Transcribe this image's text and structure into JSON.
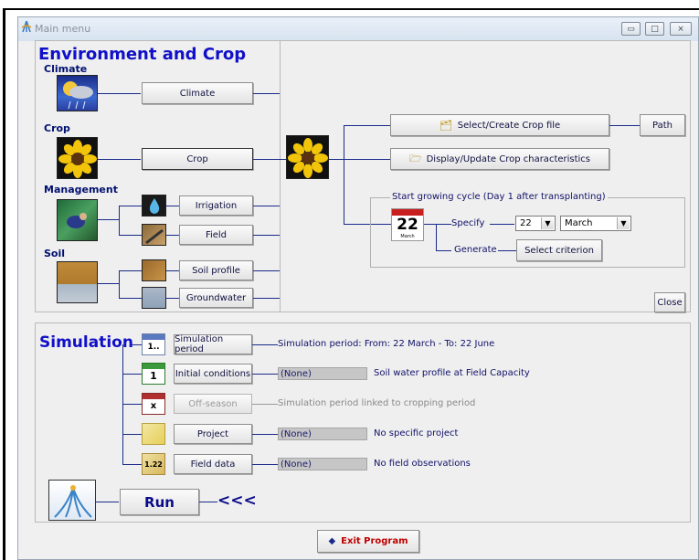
{
  "window": {
    "title": "Main menu",
    "controls": {
      "minimize": "▭",
      "maximize": "□",
      "close": "⨯"
    }
  },
  "environment": {
    "heading": "Environment and Crop",
    "climate": {
      "label": "Climate",
      "button": "Climate"
    },
    "crop": {
      "label": "Crop",
      "button": "Crop"
    },
    "management": {
      "label": "Management",
      "irrigation": "Irrigation",
      "field": "Field"
    },
    "soil": {
      "label": "Soil",
      "profile": "Soil profile",
      "groundwater": "Groundwater"
    }
  },
  "crop_panel": {
    "select_create": "Select/Create Crop file",
    "path": "Path",
    "display_update": "Display/Update Crop characteristics",
    "group_title": "Start growing cycle (Day 1 after transplanting)",
    "calendar_day": "22",
    "calendar_month": "March",
    "specify": "Specify",
    "day_value": "22",
    "month_value": "March",
    "generate": "Generate",
    "select_criterion": "Select criterion",
    "close": "Close"
  },
  "simulation": {
    "heading": "Simulation",
    "period_button": "Simulation period",
    "period_text": "Simulation period: From: 22 March - To: 22 June",
    "period_icon": "1..",
    "initial_button": "Initial conditions",
    "initial_value": "(None)",
    "initial_text": "Soil water profile at Field Capacity",
    "initial_icon": "1",
    "offseason_button": "Off-season",
    "offseason_text": "Simulation period linked to cropping period",
    "offseason_icon": "x",
    "project_button": "Project",
    "project_value": "(None)",
    "project_text": "No specific project",
    "fielddata_button": "Field data",
    "fielddata_value": "(None)",
    "fielddata_text": "No field observations",
    "fielddata_icon": "1.22",
    "run_button": "Run",
    "run_arrows": "<<<"
  },
  "exit_button": "Exit Program"
}
